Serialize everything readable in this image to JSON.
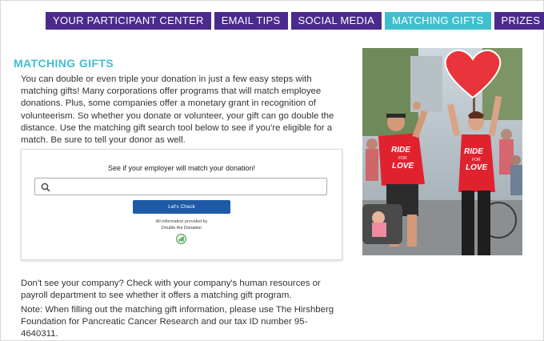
{
  "tabs": [
    {
      "label": "YOUR PARTICIPANT CENTER",
      "active": false
    },
    {
      "label": "EMAIL TIPS",
      "active": false
    },
    {
      "label": "SOCIAL MEDIA",
      "active": false
    },
    {
      "label": "MATCHING GIFTS",
      "active": true
    },
    {
      "label": "PRIZES",
      "active": false
    }
  ],
  "main": {
    "heading": "MATCHING GIFTS",
    "intro": "You can double or even triple your donation in just a few easy steps with matching gifts! Many corporations offer programs that will match employee donations. Plus, some companies offer a monetary grant in recognition of volunteerism. So whether you donate or volunteer, your gift can go double the distance. Use the matching gift search tool below to see if you're eligible for a match. Be sure to tell your donor as well.",
    "followup": "Don't see your company? Check with your company's human resources or payroll department to see whether it offers a matching gift program.",
    "note": "Note: When filling out the matching gift information, please use The Hirshberg Foundation for Pancreatic Cancer Research and our tax ID number 95-4640311."
  },
  "widget": {
    "prompt": "See if your employer will match your donation!",
    "search_value": "",
    "button_label": "Let's Check",
    "info_line": "All information provided by",
    "brand": "Double the Donation"
  },
  "photo": {
    "shirt_text_1": "RIDE",
    "shirt_text_2": "FOR",
    "shirt_text_3": "LOVE"
  },
  "colors": {
    "tab_bg": "#4b2a8e",
    "tab_active_bg": "#3fbfce",
    "heading": "#3fbfce",
    "button": "#1f5aa6",
    "heart": "#e8343a"
  }
}
